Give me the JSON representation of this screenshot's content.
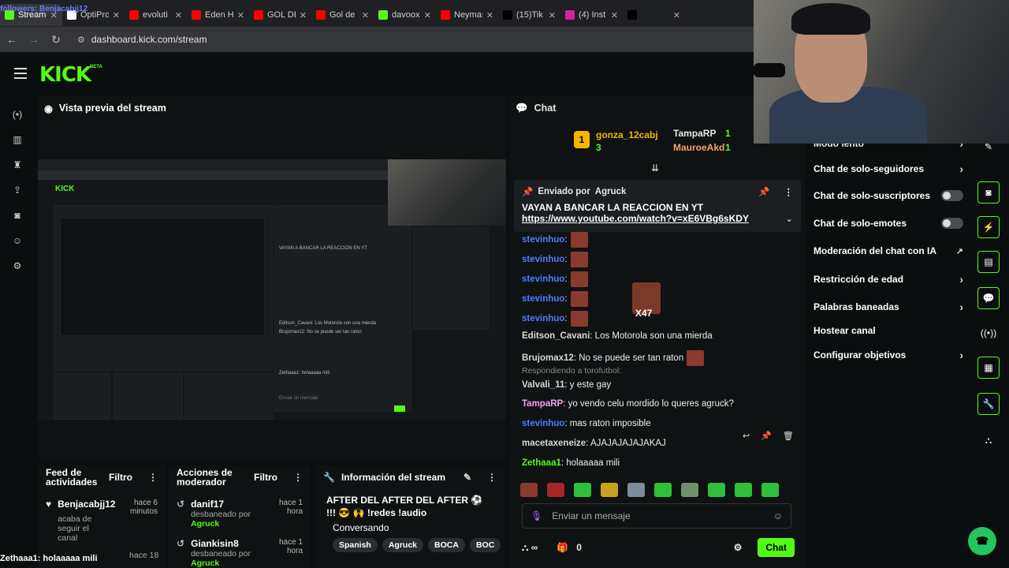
{
  "browser": {
    "overlay_follower": "followers: Benjacabjj12",
    "tabs": [
      {
        "label": "Stream",
        "color": "#53fc18",
        "active": true
      },
      {
        "label": "OptiPro",
        "color": "#ffffff"
      },
      {
        "label": "evoluti",
        "color": "#ff0000"
      },
      {
        "label": "Eden H",
        "color": "#ff0000"
      },
      {
        "label": "GOL DE",
        "color": "#ff0000"
      },
      {
        "label": "Gol de",
        "color": "#ff0000"
      },
      {
        "label": "davoox",
        "color": "#53fc18"
      },
      {
        "label": "Neymar",
        "color": "#ff0000"
      },
      {
        "label": "(15)Tik",
        "color": "#000000"
      },
      {
        "label": "(4) Inst",
        "color": "#d6249f"
      },
      {
        "label": "",
        "color": "#000000"
      }
    ],
    "url": "dashboard.kick.com/stream"
  },
  "kick": {
    "logo": "KICK",
    "beta": "BETA"
  },
  "preview": {
    "title": "Vista previa del stream"
  },
  "feed": {
    "title": "Feed de actividades",
    "filter": "Filtro",
    "items": [
      {
        "user": "Benjacabjj12",
        "time": "hace 6 minutos",
        "desc": "acaba de seguir el canal"
      }
    ],
    "partial_time": "hace 18"
  },
  "mod": {
    "title": "Acciones de moderador",
    "filter": "Filtro",
    "items": [
      {
        "user": "danif17",
        "time": "hace 1 hora",
        "desc": "desbaneado por",
        "by": "Agruck"
      },
      {
        "user": "Giankisin8",
        "time": "hace 1 hora",
        "desc": "desbaneado por",
        "by": "Agruck"
      }
    ]
  },
  "info": {
    "title": "Información del stream",
    "stream_title": "AFTER DEL AFTER DEL AFTER ⚽ !!! 😎 🙌 !redes !audio",
    "category": "Conversando",
    "tags": [
      "Spanish",
      "Agruck",
      "BOCA",
      "BOC"
    ]
  },
  "chat": {
    "title": "Chat",
    "leaderboard": {
      "top_user": "gonza_12cabj",
      "top_count": "3",
      "second_user": "TampaRP",
      "second_count": "1",
      "third_user": "MauroeAkd",
      "third_count": "1"
    },
    "pinned": {
      "sent_by_label": "Enviado por",
      "sent_by_user": "Agruck",
      "message": "VAYAN A BANCAR LA REACCION EN YT",
      "link": "https://www.youtube.com/watch?v=xE6VBg6sKDY"
    },
    "messages": [
      {
        "user": "stevinhuo",
        "text": ":",
        "color": "#4f7cff"
      },
      {
        "user": "stevinhuo",
        "text": ":",
        "color": "#4f7cff"
      },
      {
        "user": "stevinhuo",
        "text": ":",
        "color": "#4f7cff"
      },
      {
        "user": "stevinhuo",
        "text": ":",
        "color": "#4f7cff"
      },
      {
        "user": "stevinhuo",
        "text": ":",
        "color": "#4f7cff"
      },
      {
        "user": "Editson_Cavani",
        "text": ": Los Motorola son una mierda",
        "color": "#d8d8d8"
      },
      {
        "user": "Brujomax12",
        "text": ": No se puede ser tan raton",
        "color": "#d8d8d8"
      },
      {
        "user": "Valvali_11",
        "text": ": y este gay",
        "color": "#d8d8d8",
        "reply": "Respondiendo a torofutbol:"
      },
      {
        "user": "TampaRP",
        "text": ": yo vendo celu mordido lo queres agruck?",
        "color": "#ff9bf0"
      },
      {
        "user": "stevinhuo",
        "text": ": mas raton imposible",
        "color": "#4f7cff"
      },
      {
        "user": "macetaxeneize",
        "text": ": AJAJAJAJAJAKAJ",
        "color": "#d8d8d8"
      },
      {
        "user": "Zethaaa1",
        "text": ": holaaaaa mili",
        "color": "#53fc18"
      }
    ],
    "emote_multiplier": "X47",
    "input_placeholder": "Enviar un mensaje",
    "footer_count": "0",
    "send_label": "Chat"
  },
  "settings": {
    "partial_top": "Modo lento",
    "items": [
      {
        "label": "Chat de solo-seguidores",
        "kind": "chevron"
      },
      {
        "label": "Chat de solo-suscriptores",
        "kind": "toggle"
      },
      {
        "label": "Chat de solo-emotes",
        "kind": "toggle"
      },
      {
        "label": "Moderación del chat con IA",
        "kind": "external"
      },
      {
        "label": "Restricción de edad",
        "kind": "chevron"
      },
      {
        "label": "Palabras baneadas",
        "kind": "chevron"
      },
      {
        "label": "Hostear canal",
        "kind": "none"
      },
      {
        "label": "Configurar objetivos",
        "kind": "chevron"
      }
    ]
  },
  "overlay_bottom": "Zethaaa1: holaaaaa mili"
}
